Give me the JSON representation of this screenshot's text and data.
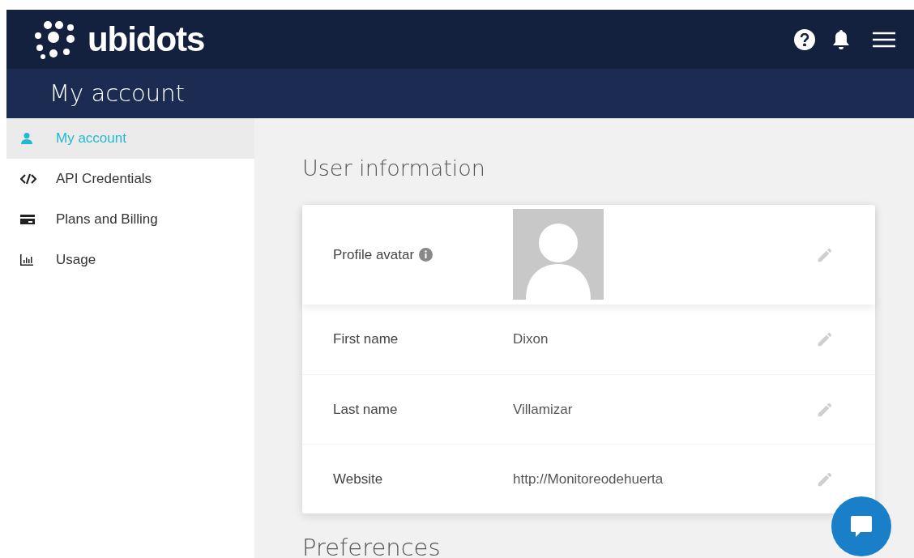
{
  "header": {
    "logo": "ubidots"
  },
  "page_title": "My account",
  "sidebar": {
    "items": [
      {
        "label": "My account",
        "kind": "user",
        "selected": true
      },
      {
        "label": "API Credentials",
        "kind": "code",
        "selected": false
      },
      {
        "label": "Plans and Billing",
        "kind": "card",
        "selected": false
      },
      {
        "label": "Usage",
        "kind": "chart",
        "selected": false
      }
    ]
  },
  "section_title": "User information",
  "fields": [
    {
      "kind": "avatar",
      "label": "Profile avatar"
    },
    {
      "kind": "text",
      "label": "First name",
      "value": "Dixon"
    },
    {
      "kind": "text",
      "label": "Last name",
      "value": "Villamizar"
    },
    {
      "kind": "text",
      "label": "Website",
      "value": "http://Monitoreodehuerta"
    }
  ],
  "next_section_title": "Preferences"
}
